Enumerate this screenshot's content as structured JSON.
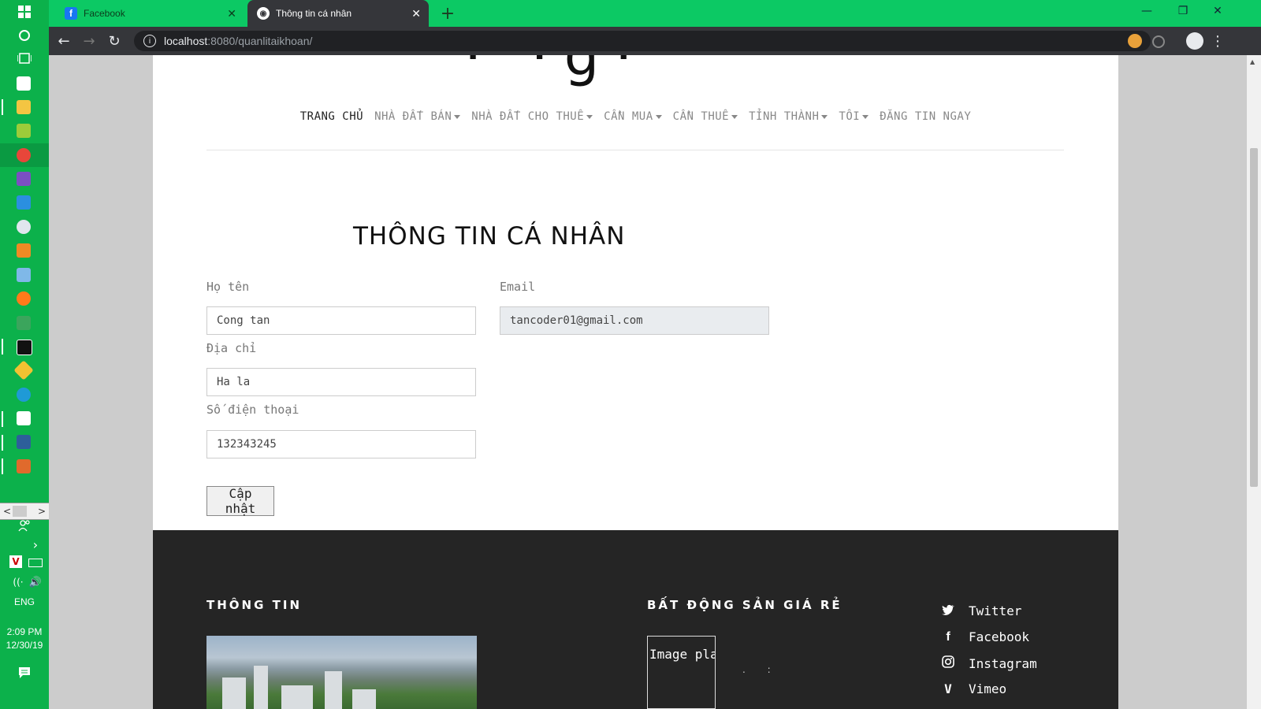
{
  "browser": {
    "tabs": [
      {
        "title": "Facebook",
        "icon": "facebook-icon"
      },
      {
        "title": "Thông tin cá nhân",
        "icon": "globe-icon"
      }
    ],
    "url_host": "localhost",
    "url_rest": ":8080/quanlitaikhoan/"
  },
  "taskbar": {
    "language": "ENG",
    "time": "2:09 PM",
    "date": "12/30/19"
  },
  "nav": {
    "items": [
      "TRANG CHỦ",
      "NHÀ ĐẤT BÁN",
      "NHÀ ĐẤT CHO THUÊ",
      "CẦN MUA",
      "CẦN THUÊ",
      "TỈNH THÀNH",
      "TÔI",
      "ĐĂNG TIN NGAY"
    ]
  },
  "form": {
    "title": "THÔNG TIN CÁ NHÂN",
    "name_label": "Họ tên",
    "name_value": "Cong tan",
    "email_label": "Email",
    "email_value": "tancoder01@gmail.com",
    "address_label": "Địa chỉ",
    "address_value": "Ha la",
    "phone_label": "Số điện thoại",
    "phone_value": "132343245",
    "submit_label": "Cập nhật"
  },
  "footer": {
    "col1_heading": "THÔNG TIN",
    "col2_heading": "BẤT ĐỘNG SẢN GIÁ RẺ",
    "image_alt": "Image placeholder",
    "social": [
      "Twitter",
      "Facebook",
      "Instagram",
      "Vimeo"
    ]
  },
  "colors": {
    "browser_frame": "#0cc964",
    "taskbar": "#0cb14b",
    "footer_bg": "#252525"
  }
}
